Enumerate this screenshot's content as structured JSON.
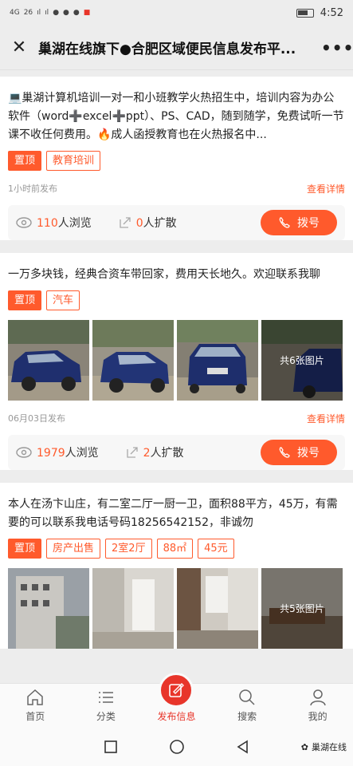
{
  "status": {
    "left": [
      "4G",
      "26",
      "ıl",
      "ıl"
    ],
    "time": "4:52"
  },
  "header": {
    "title": "巢湖在线旗下●合肥区域便民信息发布平..."
  },
  "posts": [
    {
      "text": "💻巢湖计算机培训一对一和小班教学火热招生中，培训内容为办公软件（word➕excel➕ppt）、PS、CAD，随到随学，免费试听一节课不收任何费用。🔥成人函授教育也在火热报名中...",
      "tags": [
        "置顶",
        "教育培训"
      ],
      "time": "1小时前发布",
      "detail": "查看详情",
      "views": "110",
      "views_label": "人浏览",
      "shares": "0",
      "shares_label": "人扩散",
      "dial": "拨号"
    },
    {
      "text": "一万多块钱，经典合资车带回家，费用天长地久。欢迎联系我聊",
      "tags": [
        "置顶",
        "汽车"
      ],
      "photos_more": "共6张图片",
      "time": "06月03日发布",
      "detail": "查看详情",
      "views": "1979",
      "views_label": "人浏览",
      "shares": "2",
      "shares_label": "人扩散",
      "dial": "拨号"
    },
    {
      "text": "本人在汤卞山庄，有二室二厅一厨一卫，面积88平方，45万，有需要的可以联系我电话号码18256542152，非诚勿",
      "tags": [
        "置顶",
        "房产出售",
        "2室2厅",
        "88㎡",
        "45元"
      ],
      "photos_more": "共5张图片"
    }
  ],
  "tabs": [
    "首页",
    "分类",
    "发布信息",
    "搜索",
    "我的"
  ],
  "watermark": "巢湖在线",
  "colors": {
    "accent": "#ff5a2c",
    "tab_active": "#e8352a"
  }
}
